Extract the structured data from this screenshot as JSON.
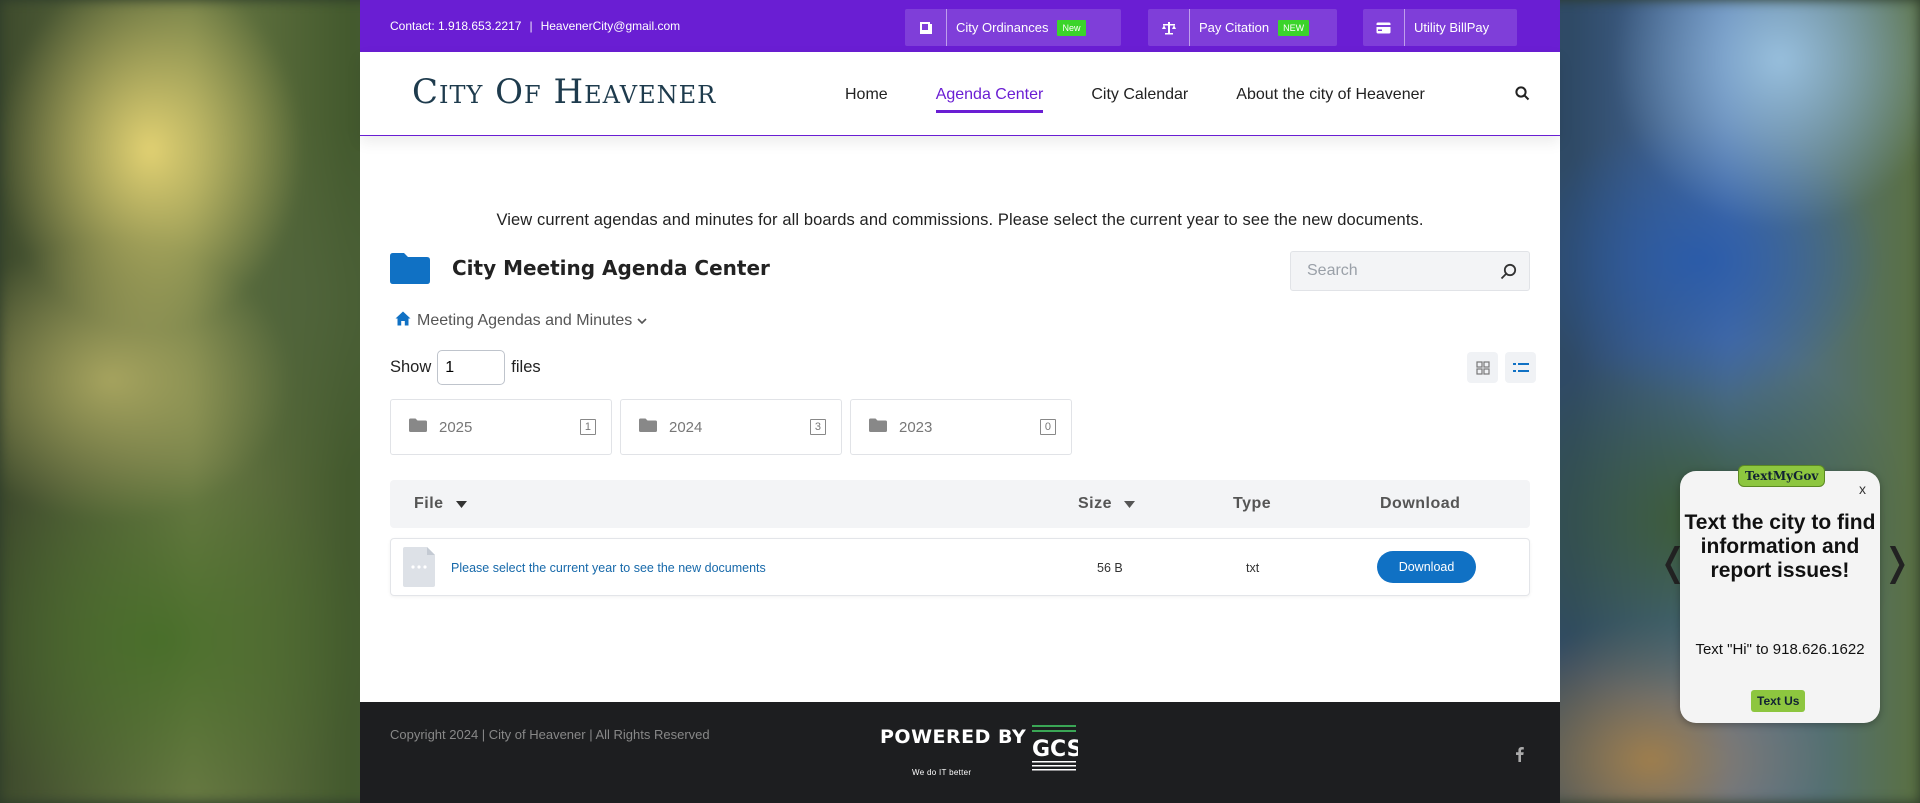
{
  "topbar": {
    "contact_phone": "Contact: 1.918.653.2217",
    "separator": "|",
    "contact_email": "HeavenerCity@gmail.com",
    "buttons": [
      {
        "label": "City Ordinances",
        "badge": "New",
        "icon": "book-icon"
      },
      {
        "label": "Pay Citation",
        "badge": "NEW",
        "icon": "scales-icon"
      },
      {
        "label": "Utility BillPay",
        "badge": "",
        "icon": "credit-card-icon"
      }
    ],
    "accent_color": "#6a1ed3",
    "badge_color": "#3bd42b"
  },
  "header": {
    "logo_text": "City Of Heavener",
    "nav": [
      {
        "label": "Home",
        "active": false
      },
      {
        "label": "Agenda Center",
        "active": true
      },
      {
        "label": "City Calendar",
        "active": false
      },
      {
        "label": "About the city of Heavener",
        "active": false
      }
    ],
    "search_icon": "search-icon"
  },
  "main": {
    "intro": "View current agendas and minutes for all boards and commissions. Please select the current year to see the new documents.",
    "title": "City Meeting Agenda Center",
    "search_placeholder": "Search",
    "breadcrumb": "Meeting Agendas and Minutes",
    "show_label": "Show",
    "show_value": "1",
    "files_label": "files",
    "folders": [
      {
        "name": "2025",
        "count": "1"
      },
      {
        "name": "2024",
        "count": "3"
      },
      {
        "name": "2023",
        "count": "0"
      }
    ],
    "table": {
      "headers": {
        "file": "File",
        "size": "Size",
        "type": "Type",
        "download": "Download"
      },
      "rows": [
        {
          "file": "Please select the current year to see the new documents",
          "size": "56 B",
          "type": "txt",
          "action": "Download"
        }
      ]
    },
    "link_color": "#1769aa",
    "button_color": "#1071c4"
  },
  "footer": {
    "copyright": "Copyright 2024 | City of Heavener | All Rights Reserved",
    "powered_by": "POWERED BY",
    "powered_tagline": "We do IT better",
    "social_icon": "facebook-icon"
  },
  "widget": {
    "brand": "TextMyGov",
    "close": "x",
    "headline": "Text the city to find information and report issues!",
    "instruction": "Text \"Hi\" to 918.626.1622",
    "button": "Text Us",
    "prev": "❬",
    "next": "❭"
  }
}
